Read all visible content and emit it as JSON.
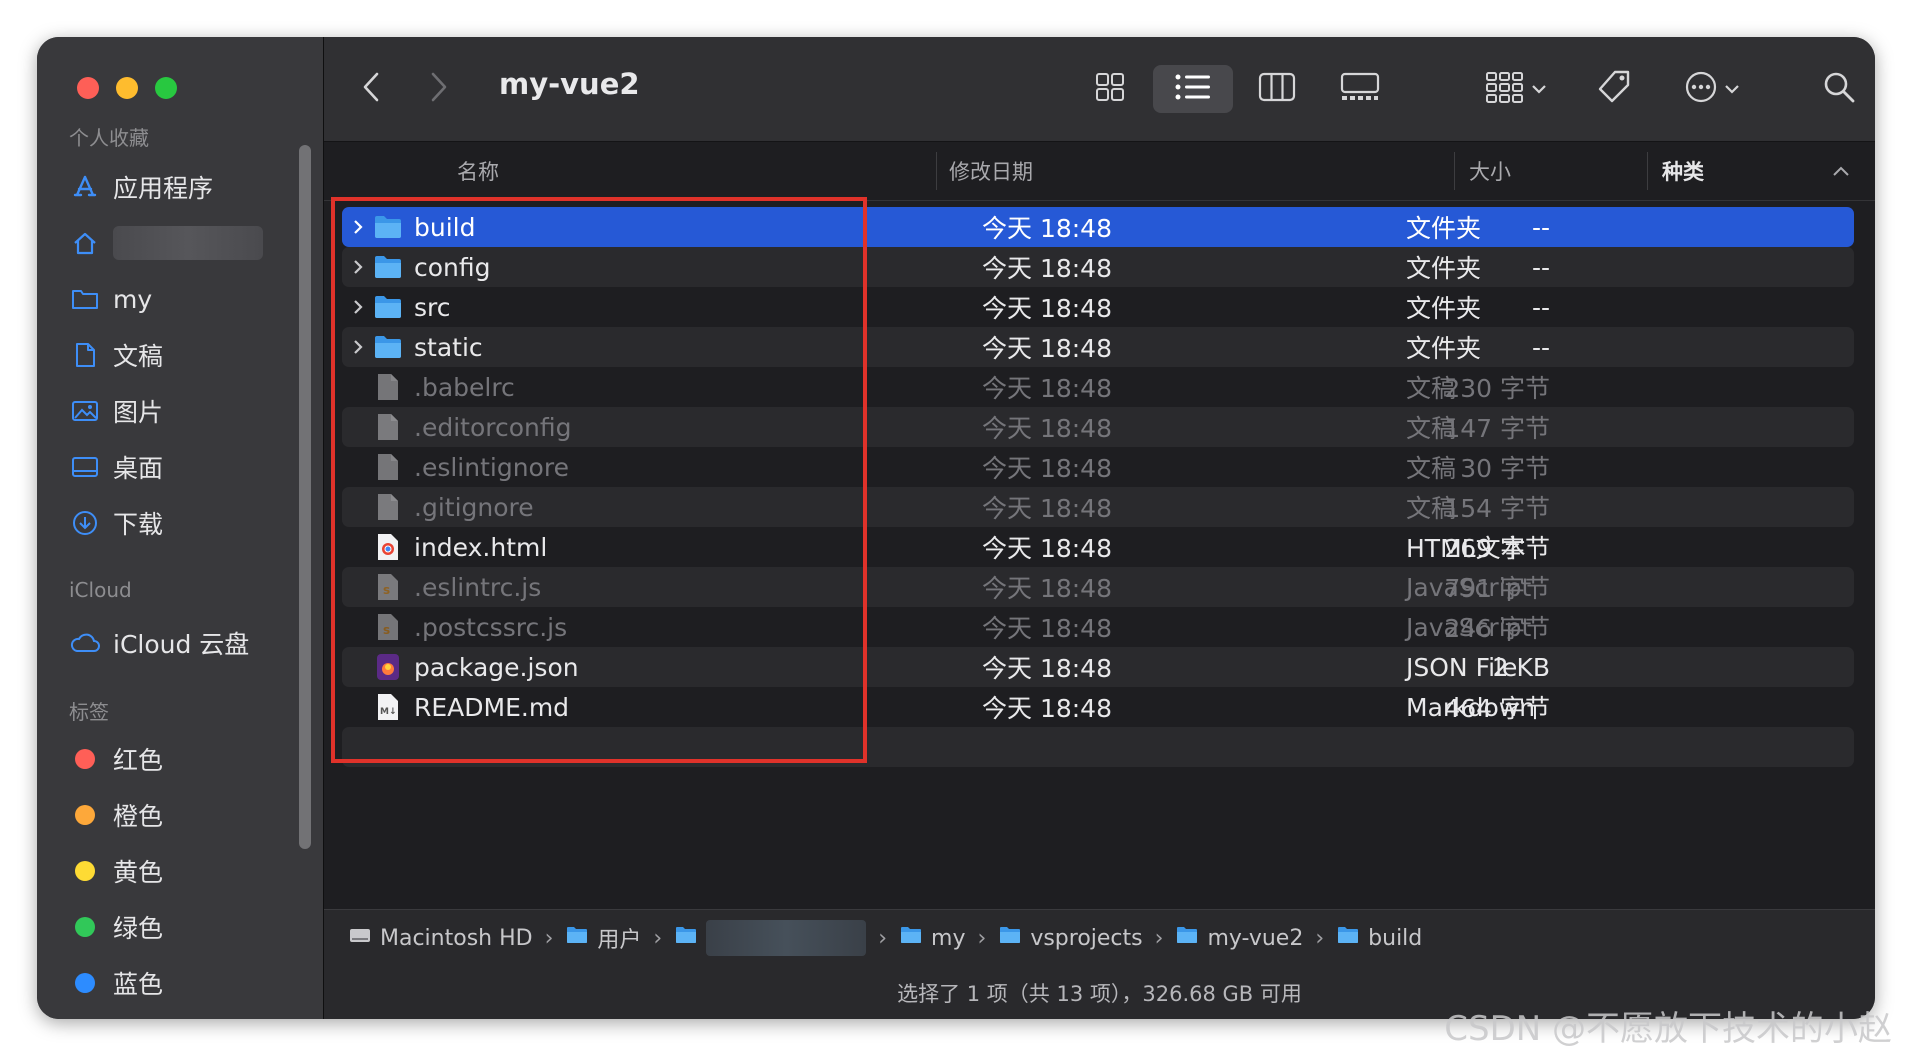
{
  "window": {
    "title": "my-vue2"
  },
  "sidebar": {
    "sections": {
      "favorites": "个人收藏",
      "icloud": "iCloud",
      "tags": "标签"
    },
    "favorites": [
      {
        "label": "应用程序",
        "icon": "applications-icon"
      },
      {
        "label": "",
        "icon": "home-icon"
      },
      {
        "label": "my",
        "icon": "folder-icon"
      },
      {
        "label": "文稿",
        "icon": "document-icon"
      },
      {
        "label": "图片",
        "icon": "pictures-icon"
      },
      {
        "label": "桌面",
        "icon": "desktop-icon"
      },
      {
        "label": "下载",
        "icon": "download-icon"
      }
    ],
    "icloud": [
      {
        "label": "iCloud 云盘",
        "icon": "cloud-icon"
      }
    ],
    "tags": [
      {
        "label": "红色",
        "color": "#ff5f57"
      },
      {
        "label": "橙色",
        "color": "#fda83a"
      },
      {
        "label": "黄色",
        "color": "#fedb34"
      },
      {
        "label": "绿色",
        "color": "#31c859"
      },
      {
        "label": "蓝色",
        "color": "#2d8cff"
      }
    ]
  },
  "columns": {
    "name": "名称",
    "date": "修改日期",
    "size": "大小",
    "kind": "种类"
  },
  "files": [
    {
      "name": "build",
      "date": "今天 18:48",
      "size": "--",
      "kind": "文件夹",
      "type": "folder",
      "selected": true,
      "dim": false
    },
    {
      "name": "config",
      "date": "今天 18:48",
      "size": "--",
      "kind": "文件夹",
      "type": "folder",
      "selected": false,
      "dim": false
    },
    {
      "name": "src",
      "date": "今天 18:48",
      "size": "--",
      "kind": "文件夹",
      "type": "folder",
      "selected": false,
      "dim": false
    },
    {
      "name": "static",
      "date": "今天 18:48",
      "size": "--",
      "kind": "文件夹",
      "type": "folder",
      "selected": false,
      "dim": false
    },
    {
      "name": ".babelrc",
      "date": "今天 18:48",
      "size": "230 字节",
      "kind": "文稿",
      "type": "doc",
      "selected": false,
      "dim": true
    },
    {
      "name": ".editorconfig",
      "date": "今天 18:48",
      "size": "147 字节",
      "kind": "文稿",
      "type": "doc",
      "selected": false,
      "dim": true
    },
    {
      "name": ".eslintignore",
      "date": "今天 18:48",
      "size": "30 字节",
      "kind": "文稿",
      "type": "doc",
      "selected": false,
      "dim": true
    },
    {
      "name": ".gitignore",
      "date": "今天 18:48",
      "size": "154 字节",
      "kind": "文稿",
      "type": "doc",
      "selected": false,
      "dim": true
    },
    {
      "name": "index.html",
      "date": "今天 18:48",
      "size": "269 字节",
      "kind": "HTML文本",
      "type": "html",
      "selected": false,
      "dim": false
    },
    {
      "name": ".eslintrc.js",
      "date": "今天 18:48",
      "size": "791 字节",
      "kind": "JavaScript",
      "type": "js",
      "selected": false,
      "dim": true
    },
    {
      "name": ".postcssrc.js",
      "date": "今天 18:48",
      "size": "246 字节",
      "kind": "JavaScript",
      "type": "js",
      "selected": false,
      "dim": true
    },
    {
      "name": "package.json",
      "date": "今天 18:48",
      "size": "2 KB",
      "kind": "JSON File",
      "type": "json",
      "selected": false,
      "dim": false
    },
    {
      "name": "README.md",
      "date": "今天 18:48",
      "size": "464 字节",
      "kind": "Markdown",
      "type": "md",
      "selected": false,
      "dim": false
    }
  ],
  "pathbar": [
    {
      "label": "Macintosh HD",
      "icon": "disk-icon"
    },
    {
      "label": "用户",
      "icon": "folder-icon"
    },
    {
      "label": "",
      "icon": "folder-icon"
    },
    {
      "label": "my",
      "icon": "folder-icon"
    },
    {
      "label": "vsprojects",
      "icon": "folder-icon"
    },
    {
      "label": "my-vue2",
      "icon": "folder-icon"
    },
    {
      "label": "build",
      "icon": "folder-icon"
    }
  ],
  "status": "选择了 1 项（共 13 项），326.68 GB 可用",
  "watermark": "CSDN @不愿放下技术的小赵"
}
